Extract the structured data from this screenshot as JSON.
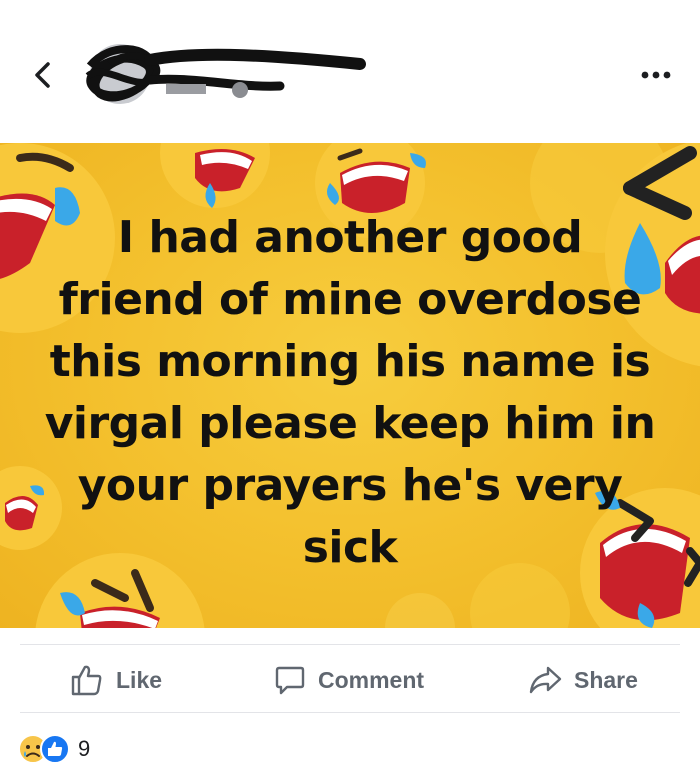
{
  "post": {
    "text": "I had another good friend of mine overdose this morning his name is virgal please keep him in your prayers he's very sick",
    "background_color": "#f3bf2c"
  },
  "actions": {
    "like_label": "Like",
    "comment_label": "Comment",
    "share_label": "Share"
  },
  "reactions": {
    "count": "9",
    "icons": [
      "sad-reaction-icon",
      "like-reaction-icon"
    ]
  },
  "icons": {
    "back": "chevron-left-icon",
    "menu": "more-options-icon"
  },
  "colors": {
    "action_text": "#606770",
    "like_blue": "#1877f2",
    "divider": "#e3e4e8"
  }
}
